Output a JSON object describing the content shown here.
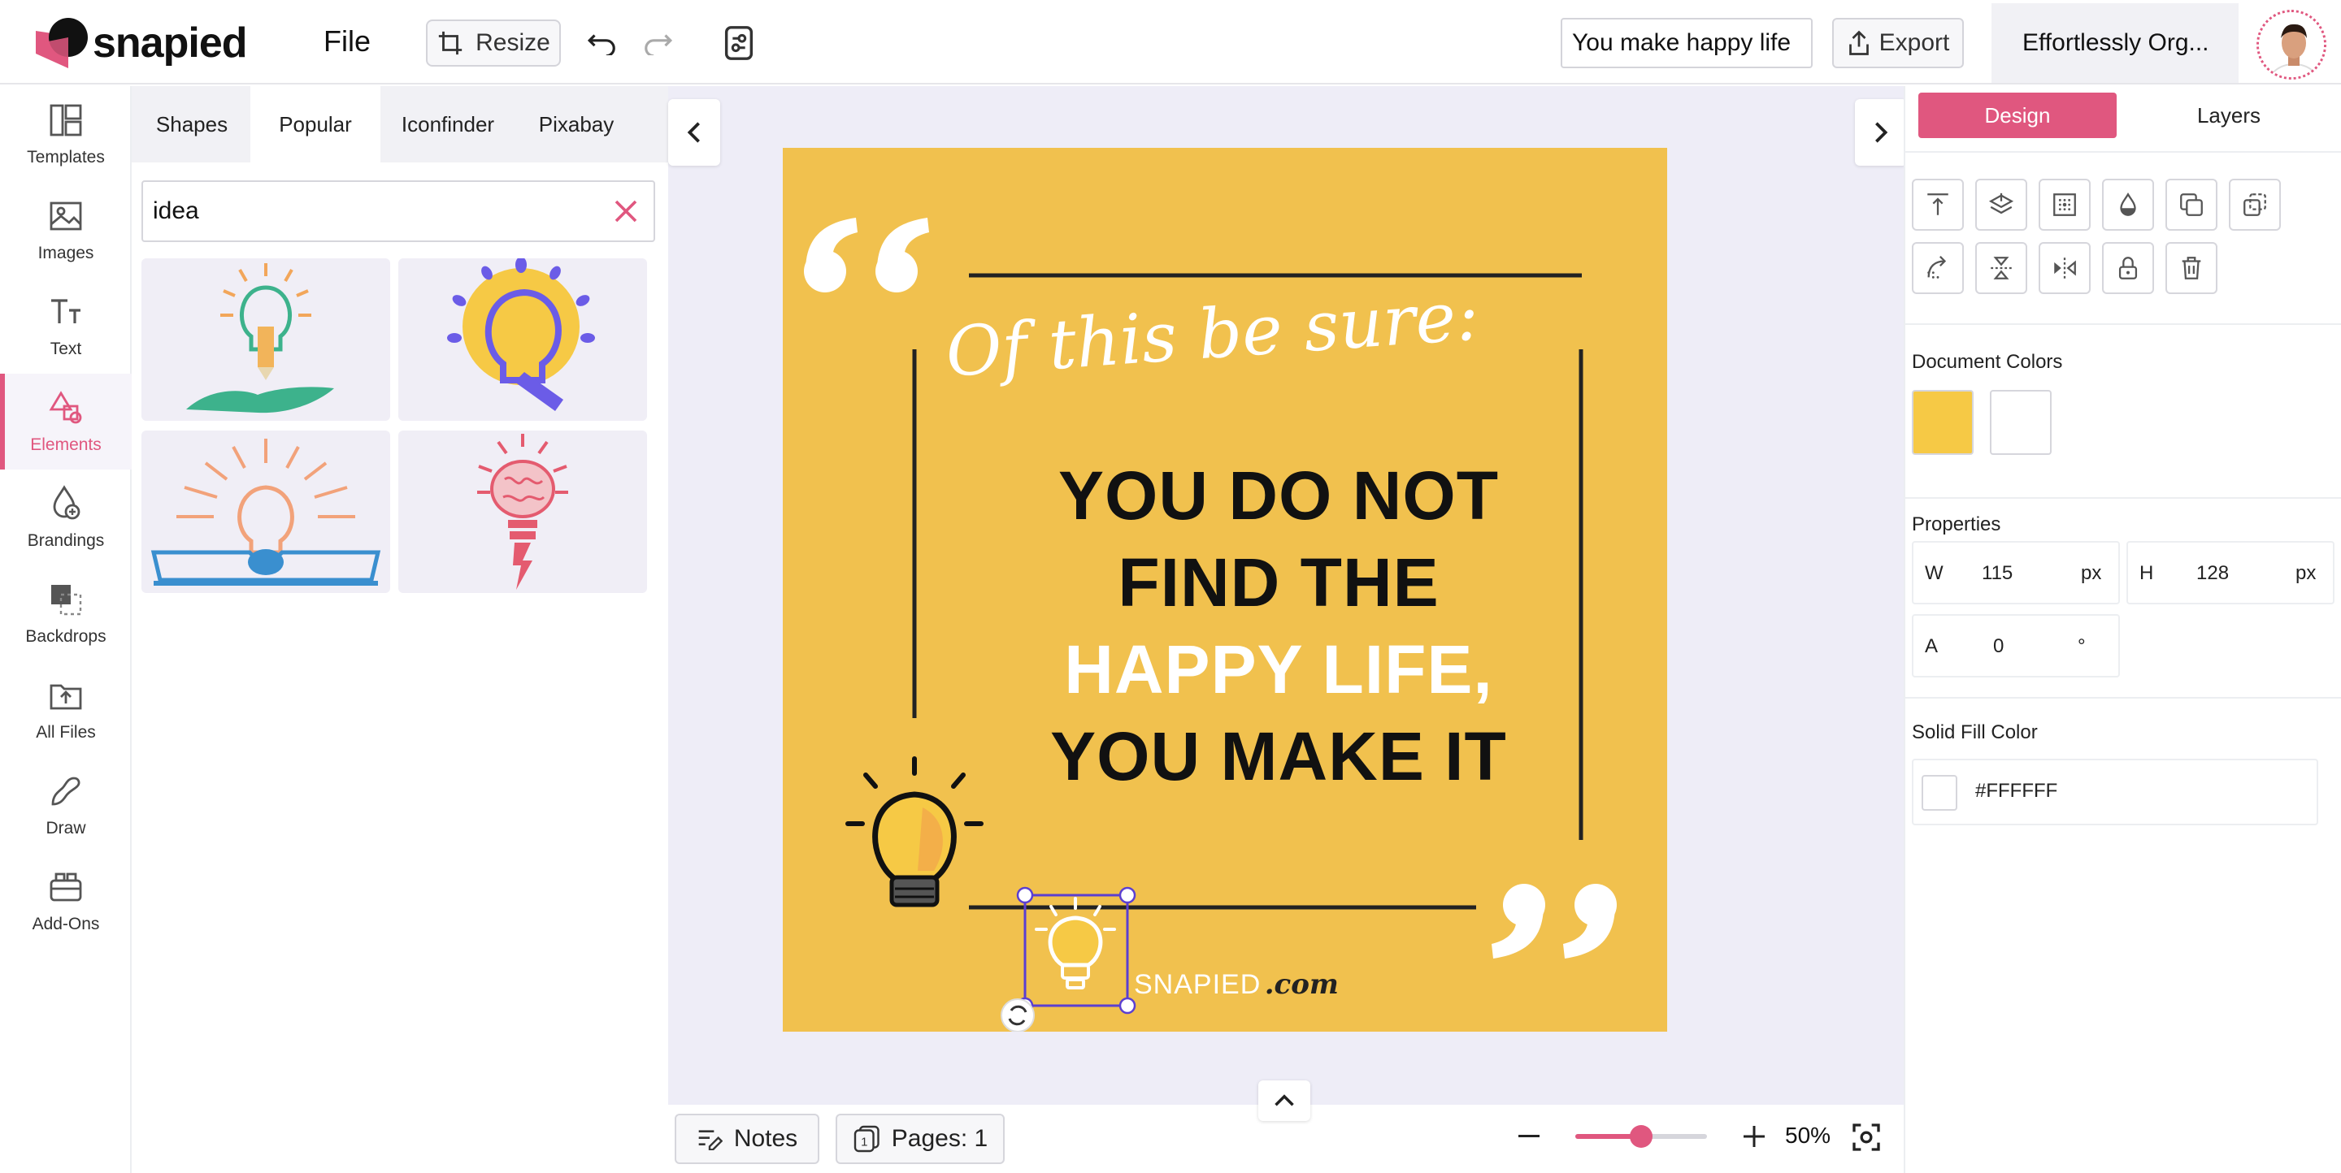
{
  "app": {
    "brand": "snapied",
    "file_menu": "File",
    "resize_label": "Resize",
    "design_title": "You make happy life",
    "export_label": "Export",
    "org_tab": "Effortlessly Org...",
    "accent": "#e0577f"
  },
  "left_nav": {
    "items": [
      {
        "label": "Templates",
        "icon": "templates-icon"
      },
      {
        "label": "Images",
        "icon": "images-icon"
      },
      {
        "label": "Text",
        "icon": "text-icon"
      },
      {
        "label": "Elements",
        "icon": "elements-icon",
        "active": true
      },
      {
        "label": "Brandings",
        "icon": "brandings-icon"
      },
      {
        "label": "Backdrops",
        "icon": "backdrops-icon"
      },
      {
        "label": "All Files",
        "icon": "all-files-icon"
      },
      {
        "label": "Draw",
        "icon": "draw-icon"
      },
      {
        "label": "Add-Ons",
        "icon": "add-ons-icon"
      }
    ]
  },
  "elements_panel": {
    "tabs": [
      {
        "label": "Shapes"
      },
      {
        "label": "Popular",
        "active": true
      },
      {
        "label": "Iconfinder"
      },
      {
        "label": "Pixabay"
      }
    ],
    "search_value": "idea",
    "results": [
      {
        "name": "lightbulb-hand"
      },
      {
        "name": "lightbulb-sun"
      },
      {
        "name": "lightbulb-book"
      },
      {
        "name": "lightbulb-brain"
      }
    ]
  },
  "canvas": {
    "script_line": "Of this be sure:",
    "lines": [
      {
        "text": "YOU DO NOT",
        "color": "#111111"
      },
      {
        "text": "FIND THE",
        "color": "#111111"
      },
      {
        "text": "HAPPY LIFE,",
        "color": "#ffffff"
      },
      {
        "text": "YOU MAKE IT",
        "color": "#111111"
      }
    ],
    "brand_a": "SNAPIED",
    "brand_b": ".com",
    "background": "#f1c14e"
  },
  "bottom_bar": {
    "notes_label": "Notes",
    "pages_label": "Pages: 1",
    "pages_badge": "1",
    "zoom_value": "50%",
    "zoom_fraction": 0.5
  },
  "right_panel": {
    "tab_design": "Design",
    "tab_layers": "Layers",
    "tools_row1": [
      "align-top-icon",
      "layers-icon",
      "grid-icon",
      "opacity-icon",
      "duplicate-icon",
      "copy-style-icon"
    ],
    "tools_row2": [
      "curve-icon",
      "flip-vertical-icon",
      "flip-horizontal-icon",
      "lock-icon",
      "trash-icon"
    ],
    "document_colors_title": "Document Colors",
    "document_colors": [
      "#f6c945",
      "#ffffff"
    ],
    "properties_title": "Properties",
    "width_label": "W",
    "width_value": "115",
    "width_unit": "px",
    "height_label": "H",
    "height_value": "128",
    "height_unit": "px",
    "angle_label": "A",
    "angle_value": "0",
    "angle_unit": "°",
    "fill_title": "Solid Fill Color",
    "fill_hex": "#FFFFFF"
  }
}
